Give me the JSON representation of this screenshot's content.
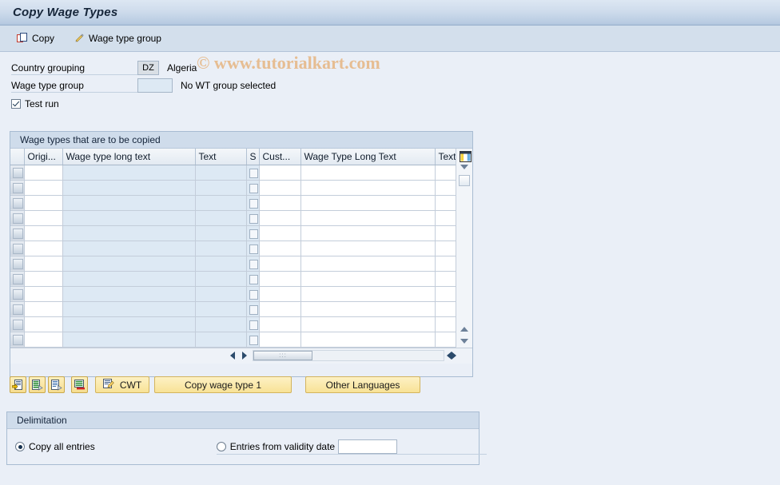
{
  "window": {
    "title": "Copy Wage Types"
  },
  "toolbar": {
    "copy_label": "Copy",
    "wage_type_group_label": "Wage type group",
    "copy_icon": "copy-icon",
    "wage_type_group_icon": "pencil-icon"
  },
  "watermark": {
    "text": "© www.tutorialkart.com"
  },
  "form": {
    "country_grouping_label": "Country grouping",
    "country_grouping_value": "DZ",
    "country_grouping_desc": "Algeria",
    "wage_type_group_label": "Wage type group",
    "wage_type_group_value": "",
    "wage_type_group_desc": "No WT group selected",
    "test_run_label": "Test run",
    "test_run_checked": true
  },
  "table": {
    "caption": "Wage types that are to be copied",
    "columns": [
      {
        "key": "sel",
        "label": ""
      },
      {
        "key": "orig",
        "label": "Origi..."
      },
      {
        "key": "wlong",
        "label": "Wage type long text"
      },
      {
        "key": "text1",
        "label": "Text"
      },
      {
        "key": "s",
        "label": "S"
      },
      {
        "key": "cust",
        "label": "Cust..."
      },
      {
        "key": "wlong2",
        "label": "Wage Type Long Text"
      },
      {
        "key": "text2",
        "label": "Text"
      }
    ],
    "config_icon": "column-settings-icon",
    "row_count": 12,
    "rows": [
      {
        "orig": "",
        "wlong": "",
        "text1": "",
        "s": "",
        "cust": "",
        "wlong2": "",
        "text2": ""
      },
      {
        "orig": "",
        "wlong": "",
        "text1": "",
        "s": "",
        "cust": "",
        "wlong2": "",
        "text2": ""
      },
      {
        "orig": "",
        "wlong": "",
        "text1": "",
        "s": "",
        "cust": "",
        "wlong2": "",
        "text2": ""
      },
      {
        "orig": "",
        "wlong": "",
        "text1": "",
        "s": "",
        "cust": "",
        "wlong2": "",
        "text2": ""
      },
      {
        "orig": "",
        "wlong": "",
        "text1": "",
        "s": "",
        "cust": "",
        "wlong2": "",
        "text2": ""
      },
      {
        "orig": "",
        "wlong": "",
        "text1": "",
        "s": "",
        "cust": "",
        "wlong2": "",
        "text2": ""
      },
      {
        "orig": "",
        "wlong": "",
        "text1": "",
        "s": "",
        "cust": "",
        "wlong2": "",
        "text2": ""
      },
      {
        "orig": "",
        "wlong": "",
        "text1": "",
        "s": "",
        "cust": "",
        "wlong2": "",
        "text2": ""
      },
      {
        "orig": "",
        "wlong": "",
        "text1": "",
        "s": "",
        "cust": "",
        "wlong2": "",
        "text2": ""
      },
      {
        "orig": "",
        "wlong": "",
        "text1": "",
        "s": "",
        "cust": "",
        "wlong2": "",
        "text2": ""
      },
      {
        "orig": "",
        "wlong": "",
        "text1": "",
        "s": "",
        "cust": "",
        "wlong2": "",
        "text2": ""
      },
      {
        "orig": "",
        "wlong": "",
        "text1": "",
        "s": "",
        "cust": "",
        "wlong2": "",
        "text2": ""
      }
    ]
  },
  "actions": {
    "icon_buttons": [
      {
        "name": "insert-row-icon"
      },
      {
        "name": "copy-row-icon"
      },
      {
        "name": "duplicate-row-icon"
      },
      {
        "name": "delete-row-icon"
      }
    ],
    "cwt_label": "CWT",
    "cwt_icon": "edit-note-icon",
    "copy_wage_type_label": "Copy wage type 1",
    "other_languages_label": "Other Languages"
  },
  "delimitation": {
    "caption": "Delimitation",
    "copy_all_label": "Copy all entries",
    "copy_all_selected": true,
    "from_validity_label": "Entries from validity date",
    "from_validity_selected": false,
    "validity_date_value": ""
  },
  "colors": {
    "page_background": "#eaeff7",
    "titlebar_top": "#dde7f3",
    "titlebar_bottom": "#a9bfd9",
    "toolbar": "#d3dfec",
    "panel_caption": "#cfdceb",
    "button_yellow": "#f8e296",
    "watermark": "#e6b98a",
    "grid_alt_cell": "#dde9f4"
  }
}
